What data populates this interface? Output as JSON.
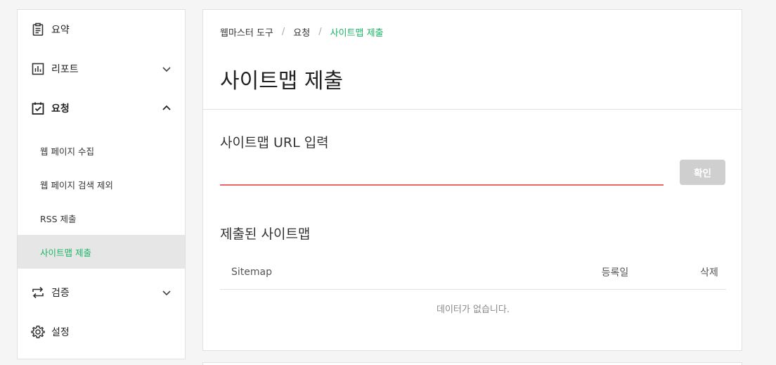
{
  "sidebar": {
    "items": [
      {
        "label": "요약",
        "icon": "clipboard-icon"
      },
      {
        "label": "리포트",
        "icon": "bar-chart-icon"
      },
      {
        "label": "요청",
        "icon": "clipboard-check-icon"
      },
      {
        "label": "검증",
        "icon": "repeat-arrows-icon"
      },
      {
        "label": "설정",
        "icon": "gear-icon"
      }
    ],
    "subitems": [
      {
        "label": "웹 페이지 수집"
      },
      {
        "label": "웹 페이지 검색 제외"
      },
      {
        "label": "RSS 제출"
      },
      {
        "label": "사이트맵 제출"
      }
    ]
  },
  "breadcrumb": {
    "root": "웹마스터 도구",
    "parent": "요청",
    "current": "사이트맵 제출",
    "separator": "/"
  },
  "main": {
    "page_title": "사이트맵 제출",
    "url_section_title": "사이트맵 URL 입력",
    "url_input_value": "",
    "confirm_label": "확인",
    "submitted_title": "제출된 사이트맵",
    "table": {
      "columns": [
        "Sitemap",
        "등록일",
        "삭제"
      ],
      "empty_text": "데이터가 없습니다."
    }
  },
  "colors": {
    "accent": "#19b464",
    "input_underline": "#ea6767",
    "button_disabled": "#cfcfcf"
  }
}
